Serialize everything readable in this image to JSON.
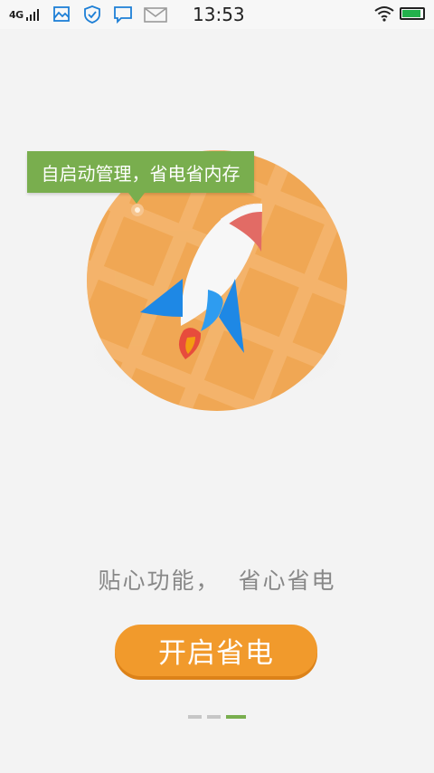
{
  "status_bar": {
    "network": "4G",
    "time": "13:53",
    "icons": [
      "signal-icon",
      "gallery-icon",
      "shield-icon",
      "chat-icon",
      "mail-icon",
      "wifi-icon",
      "battery-icon"
    ],
    "battery_level": 0.9
  },
  "illustration": {
    "tooltip": "自启动管理，省电省内存",
    "colors": {
      "plate": "#f0a754",
      "tooltip": "#79ae4e",
      "wing": "#1e88e5",
      "flame": "#e74c3c"
    }
  },
  "slogan": "贴心功能，  省心省电",
  "cta": {
    "label": "开启省电",
    "color": "#f19a2c"
  },
  "pager": {
    "total": 3,
    "active_index": 2
  }
}
